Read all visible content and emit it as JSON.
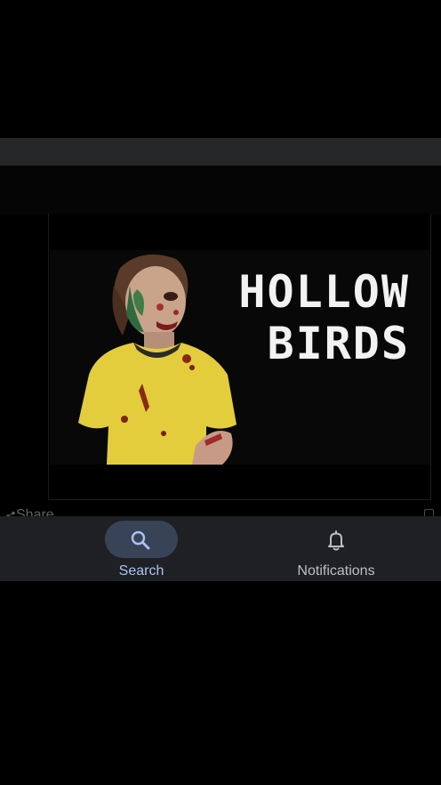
{
  "thumbnail": {
    "title_line1": "HOLLOW",
    "title_line2": "BIRDS"
  },
  "action_row": {
    "share_label": "Share"
  },
  "bottom_nav": {
    "items": [
      {
        "label": "Search",
        "icon": "search-icon",
        "active": true
      },
      {
        "label": "Notifications",
        "icon": "bell-icon",
        "active": false
      }
    ]
  },
  "colors": {
    "nav_background": "#1f2023",
    "active_pill": "#394357",
    "active_label": "#a8c4f4",
    "inactive_label": "#bdbec2"
  }
}
